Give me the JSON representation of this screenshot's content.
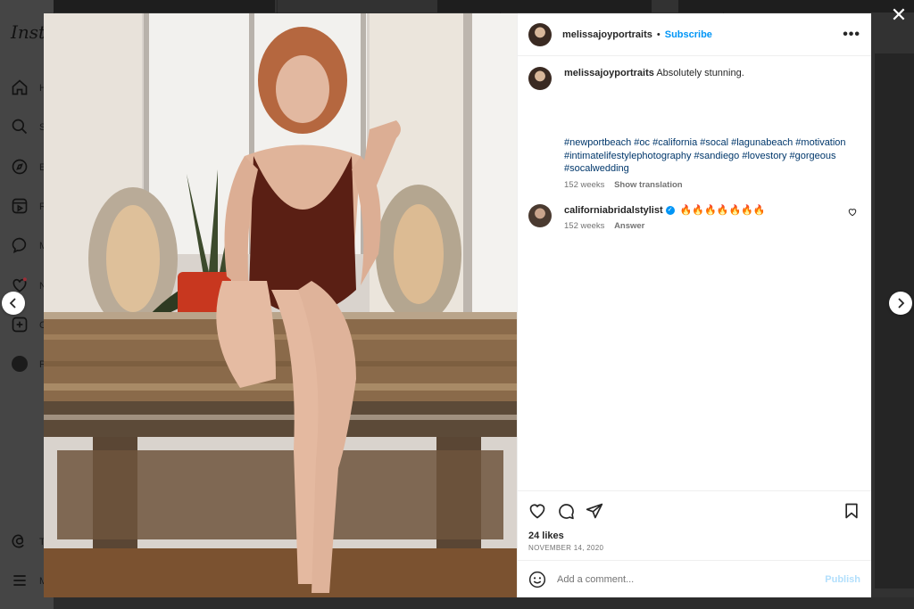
{
  "background": {
    "logo": "Insta",
    "nav": [
      {
        "label": "H",
        "icon": "home-icon"
      },
      {
        "label": "S",
        "icon": "search-icon"
      },
      {
        "label": "E",
        "icon": "explore-icon"
      },
      {
        "label": "R",
        "icon": "reels-icon"
      },
      {
        "label": "M",
        "icon": "messenger-icon"
      },
      {
        "label": "N",
        "icon": "heart-icon"
      },
      {
        "label": "C",
        "icon": "create-icon"
      },
      {
        "label": "P",
        "icon": "profile-avatar"
      },
      {
        "label": "T",
        "icon": "threads-icon"
      },
      {
        "label": "M",
        "icon": "menu-icon"
      }
    ]
  },
  "header": {
    "username": "melissajoyportraits",
    "separator": "•",
    "subscribe_label": "Subscribe",
    "more_label": "•••"
  },
  "caption": {
    "username": "melissajoyportraits",
    "text": "Absolutely stunning.",
    "hashtags": "#newportbeach #oc #california #socal #lagunabeach #motivation #intimatelifestylephotography #sandiego #lovestory #gorgeous #socalwedding",
    "age": "152 weeks",
    "translate_label": "Show translation"
  },
  "comment": {
    "username": "californiabridalstylist",
    "verified": "✓",
    "text": "🔥🔥🔥🔥🔥🔥🔥",
    "age": "152 weeks",
    "answer_label": "Answer"
  },
  "post": {
    "likes": "24 likes",
    "date": "NOVEMBER 14, 2020"
  },
  "comment_box": {
    "placeholder": "Add a comment...",
    "publish_label": "Publish"
  },
  "controls": {
    "close": "✕"
  },
  "colors": {
    "accent": "#0095f6",
    "hashtag": "#00376b",
    "muted": "#737373",
    "publish_disabled": "#b2dffc"
  }
}
